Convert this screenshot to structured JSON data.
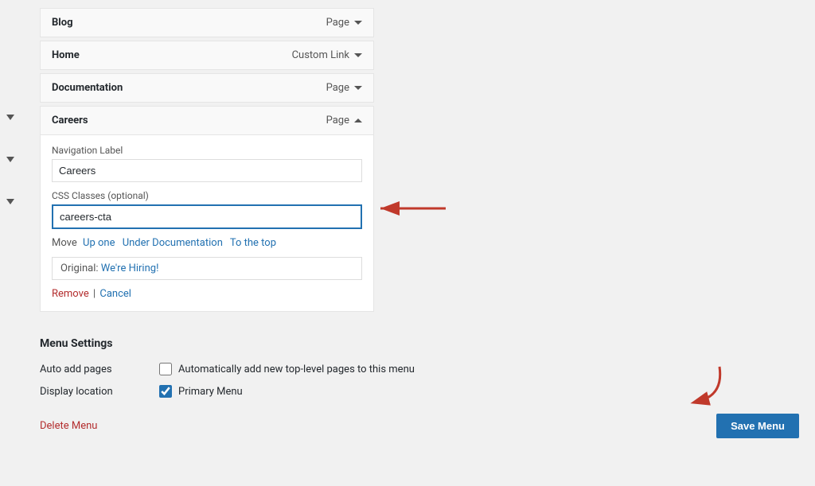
{
  "menu_items": [
    {
      "id": "blog",
      "title": "Blog",
      "type": "Page",
      "expanded": false
    },
    {
      "id": "home",
      "title": "Home",
      "type": "Custom Link",
      "expanded": false
    },
    {
      "id": "documentation",
      "title": "Documentation",
      "type": "Page",
      "expanded": false
    },
    {
      "id": "careers",
      "title": "Careers",
      "type": "Page",
      "expanded": true,
      "nav_label": "Careers",
      "css_classes": "careers-cta",
      "move_label": "Move",
      "move_links": [
        "Up one",
        "Under Documentation",
        "To the top"
      ],
      "original_label": "Original:",
      "original_link_text": "We're Hiring!",
      "original_link_url": "#",
      "remove_label": "Remove",
      "cancel_label": "Cancel"
    }
  ],
  "form_labels": {
    "nav_label": "Navigation Label",
    "css_classes": "CSS Classes (optional)"
  },
  "menu_settings": {
    "title": "Menu Settings",
    "rows": [
      {
        "label": "Auto add pages",
        "type": "checkbox",
        "checked": false,
        "description": "Automatically add new top-level pages to this menu"
      },
      {
        "label": "Display location",
        "type": "checkbox",
        "checked": true,
        "description": "Primary Menu"
      }
    ]
  },
  "footer": {
    "delete_menu_label": "Delete Menu",
    "save_menu_label": "Save Menu"
  }
}
